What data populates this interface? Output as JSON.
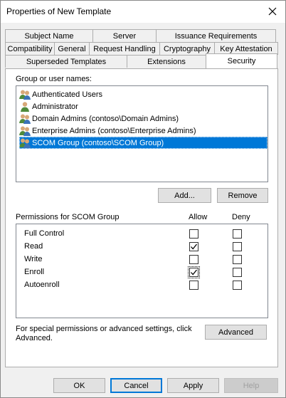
{
  "window": {
    "title": "Properties of New Template"
  },
  "tabs": {
    "row1": [
      "Subject Name",
      "Server",
      "Issuance Requirements"
    ],
    "row2": [
      "Compatibility",
      "General",
      "Request Handling",
      "Cryptography",
      "Key Attestation"
    ],
    "row3": [
      "Superseded Templates",
      "Extensions",
      "Security"
    ],
    "active": "Security"
  },
  "group_section": {
    "label": "Group or user names:",
    "items": [
      {
        "label": "Authenticated Users",
        "icon": "group-icon",
        "selected": false
      },
      {
        "label": "Administrator",
        "icon": "user-icon",
        "selected": false
      },
      {
        "label": "Domain Admins (contoso\\Domain Admins)",
        "icon": "group-icon",
        "selected": false
      },
      {
        "label": "Enterprise Admins (contoso\\Enterprise Admins)",
        "icon": "group-icon",
        "selected": false
      },
      {
        "label": "SCOM Group (contoso\\SCOM Group)",
        "icon": "group-icon",
        "selected": true
      }
    ],
    "add_label": "Add...",
    "remove_label": "Remove"
  },
  "permissions": {
    "header": "Permissions for SCOM Group",
    "allow_label": "Allow",
    "deny_label": "Deny",
    "rows": [
      {
        "name": "Full Control",
        "allow": false,
        "deny": false
      },
      {
        "name": "Read",
        "allow": true,
        "deny": false
      },
      {
        "name": "Write",
        "allow": false,
        "deny": false
      },
      {
        "name": "Enroll",
        "allow": true,
        "deny": false
      },
      {
        "name": "Autoenroll",
        "allow": false,
        "deny": false
      }
    ]
  },
  "advanced": {
    "text": "For special permissions or advanced settings, click Advanced.",
    "button_label": "Advanced"
  },
  "footer": {
    "ok_label": "OK",
    "cancel_label": "Cancel",
    "apply_label": "Apply",
    "help_label": "Help"
  },
  "colors": {
    "selection": "#0078d7",
    "dialog_bg": "#f0f0f0"
  }
}
